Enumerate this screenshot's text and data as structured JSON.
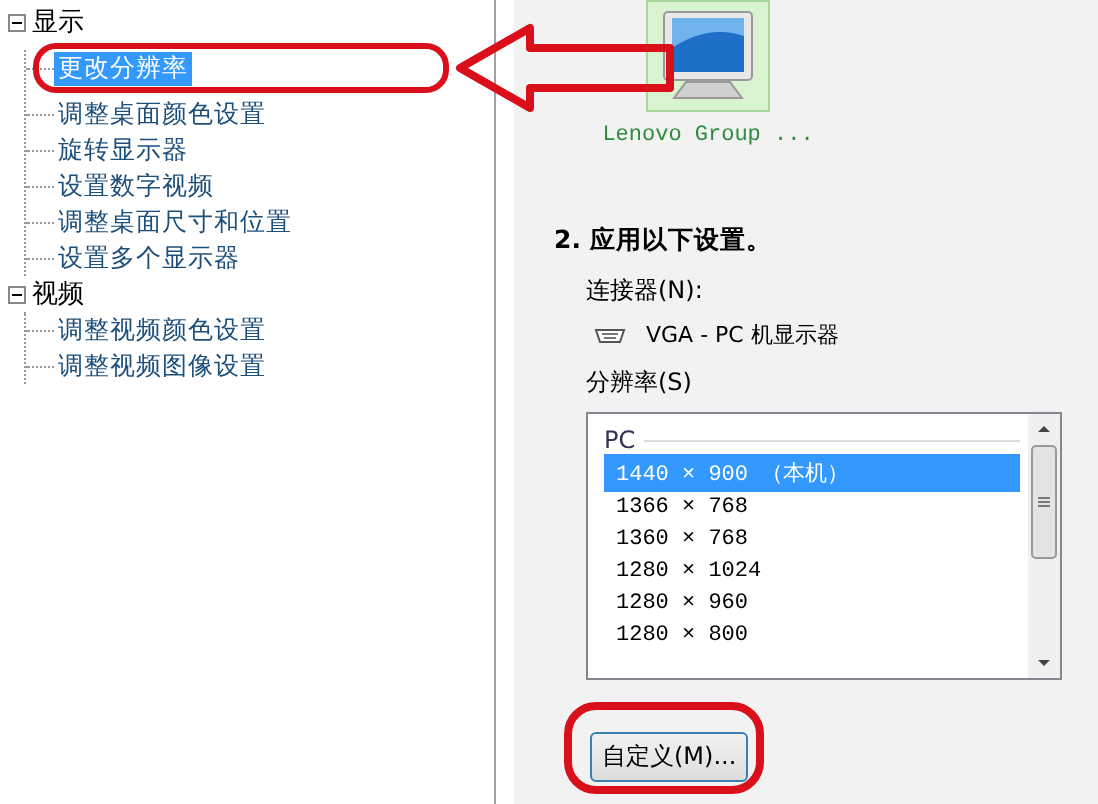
{
  "tree": [
    {
      "label": "显示",
      "expanded": true,
      "children": [
        {
          "label": "更改分辨率",
          "selected": true
        },
        {
          "label": "调整桌面颜色设置",
          "selected": false
        },
        {
          "label": "旋转显示器",
          "selected": false
        },
        {
          "label": "设置数字视频",
          "selected": false
        },
        {
          "label": "调整桌面尺寸和位置",
          "selected": false
        },
        {
          "label": "设置多个显示器",
          "selected": false
        }
      ]
    },
    {
      "label": "视频",
      "expanded": true,
      "children": [
        {
          "label": "调整视频颜色设置",
          "selected": false
        },
        {
          "label": "调整视频图像设置",
          "selected": false
        }
      ]
    }
  ],
  "display": {
    "name": "Lenovo Group ...",
    "selected": true
  },
  "step_title": "2. 应用以下设置。",
  "connector": {
    "label": "连接器(N):",
    "value": "VGA - PC 机显示器"
  },
  "resolution": {
    "label": "分辨率(S)",
    "group": "PC",
    "items": [
      {
        "label": "1440 × 900 （本机）",
        "selected": true
      },
      {
        "label": "1366 × 768",
        "selected": false
      },
      {
        "label": "1360 × 768",
        "selected": false
      },
      {
        "label": "1280 × 1024",
        "selected": false
      },
      {
        "label": "1280 × 960",
        "selected": false
      },
      {
        "label": "1280 × 800",
        "selected": false
      }
    ]
  },
  "custom_button": "自定义(M)..."
}
